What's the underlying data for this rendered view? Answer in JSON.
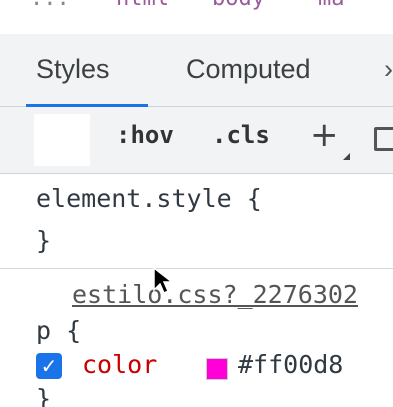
{
  "breadcrumb": [
    "...",
    "html",
    "body",
    "ma"
  ],
  "tabs": {
    "styles": "Styles",
    "computed": "Computed",
    "more": "›"
  },
  "toolbar": {
    "hov": ":hov",
    "cls": ".cls",
    "add": "+"
  },
  "element_style": {
    "selector": "element.style {",
    "close": "}"
  },
  "rule": {
    "source": "estilo.css?_2276302",
    "selector": "p {",
    "property": "color",
    "colon": ":",
    "value": "#ff00d8",
    "checkbox": "✓",
    "close": "}"
  },
  "colors": {
    "accent": "#1a73e8",
    "property_name": "#c80000",
    "swatch": "#ff00d8"
  }
}
